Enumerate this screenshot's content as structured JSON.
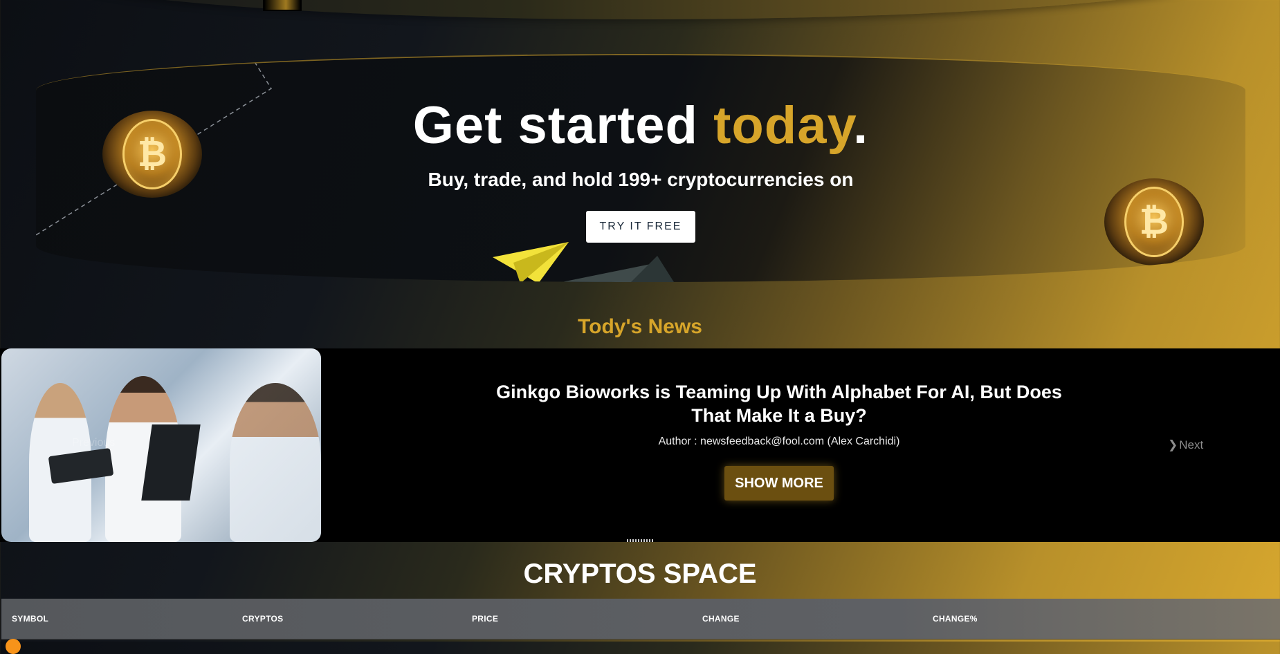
{
  "hero": {
    "title_main": "Get started ",
    "title_accent": "today",
    "title_end": ".",
    "subtitle": "Buy, trade, and hold 199+ cryptocurrencies on",
    "cta_label": "TRY IT FREE",
    "coin_icon": "bitcoin-coin"
  },
  "news": {
    "heading": "Tody's News",
    "title": "Ginkgo Bioworks is Teaming Up With Alphabet For AI, But Does That Make It a Buy?",
    "author": "Author : newsfeedback@fool.com (Alex Carchidi)",
    "show_more_label": "SHOW MORE",
    "next_label": "Next",
    "prev_label": "Previous"
  },
  "cryptos": {
    "heading": "CRYPTOS SPACE",
    "columns": [
      "SYMBOL",
      "CRYPTOS",
      "PRICE",
      "CHANGE",
      "CHANGE%"
    ]
  },
  "colors": {
    "accent": "#d7a52a",
    "button_dark_gold": "#6b4f10"
  }
}
